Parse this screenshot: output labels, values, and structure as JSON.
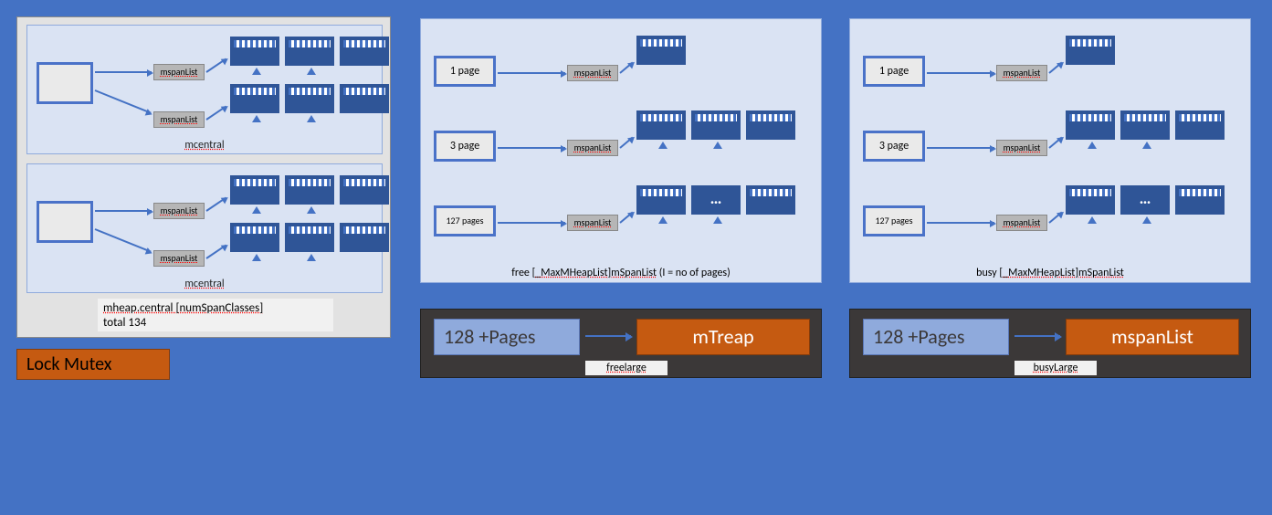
{
  "lock_mutex_label": "Lock Mutex",
  "central": {
    "mcentral_label": "mcentral",
    "mspan_chip_label": "mspanList",
    "caption_line1": "mheap.central [numSpanClasses]",
    "caption_line2": "total 134"
  },
  "pages": {
    "rows": [
      {
        "label": "1 page"
      },
      {
        "label": "3 page"
      },
      {
        "label": "127 pages"
      }
    ],
    "mspan_label": "mspanList",
    "ellipsis": "…",
    "free_footer_prefix": "free [",
    "busy_footer_prefix": "busy [",
    "footer_mid": "_MaxMHeapList",
    "footer_suffix": "]mSpanList",
    "free_footer_note": "  (I = no of pages)"
  },
  "large": {
    "left_label": "128 +Pages",
    "free_right": "mTreap",
    "busy_right": "mspanList",
    "free_label": "freelarge",
    "busy_label": "busyLarge"
  }
}
